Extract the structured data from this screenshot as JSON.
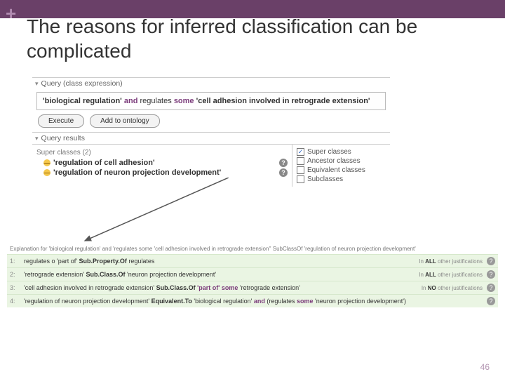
{
  "plus_symbol": "+",
  "slide_title": "The reasons for inferred classification can be complicated",
  "query": {
    "section_label": "Query (class expression)",
    "expr1": "'biological regulation'",
    "kw_and": "and",
    "expr2": "regulates",
    "kw_some": "some",
    "expr3": "'cell adhesion involved in retrograde extension'",
    "execute_label": "Execute",
    "add_label": "Add to ontology"
  },
  "results": {
    "section_label": "Query results",
    "super_label": "Super classes (2)",
    "items": [
      "'regulation of cell adhesion'",
      "'regulation of neuron projection development'"
    ],
    "filters": {
      "super": "Super classes",
      "ancestor": "Ancestor classes",
      "equiv": "Equivalent classes",
      "sub": "Subclasses"
    }
  },
  "explanation": {
    "head": "Explanation for 'biological regulation' and 'regulates some 'cell adhesion involved in retrograde extension'' SubClassOf 'regulation of neuron projection development'",
    "rows": [
      {
        "idx": "1:",
        "plain_pre": "regulates o 'part of' ",
        "bold": "Sub.Property.Of",
        "plain_post": " regulates",
        "meta_pre": "In ",
        "meta_em": "ALL",
        "meta_post": " other justifications"
      },
      {
        "idx": "2:",
        "plain_pre": "'retrograde extension' ",
        "bold": "Sub.Class.Of",
        "plain_post": " 'neuron projection development'",
        "meta_pre": "In ",
        "meta_em": "ALL",
        "meta_post": " other justifications"
      },
      {
        "idx": "3:",
        "plain_pre": "'cell adhesion involved in retrograde extension' ",
        "bold": "Sub.Class.Of",
        "kw": " 'part of' some",
        "plain_post": " 'retrograde extension'",
        "meta_pre": "In ",
        "meta_em": "NO",
        "meta_post": " other justifications"
      },
      {
        "idx": "4:",
        "plain_pre": "'regulation of neuron projection development' ",
        "bold": "Equivalent.To",
        "plain_post": " 'biological regulation' ",
        "kw": "and",
        "tail": " (regulates ",
        "kw2": "some",
        "tail2": " 'neuron projection development')",
        "meta_pre": "",
        "meta_em": "",
        "meta_post": ""
      }
    ]
  },
  "footer": "46"
}
